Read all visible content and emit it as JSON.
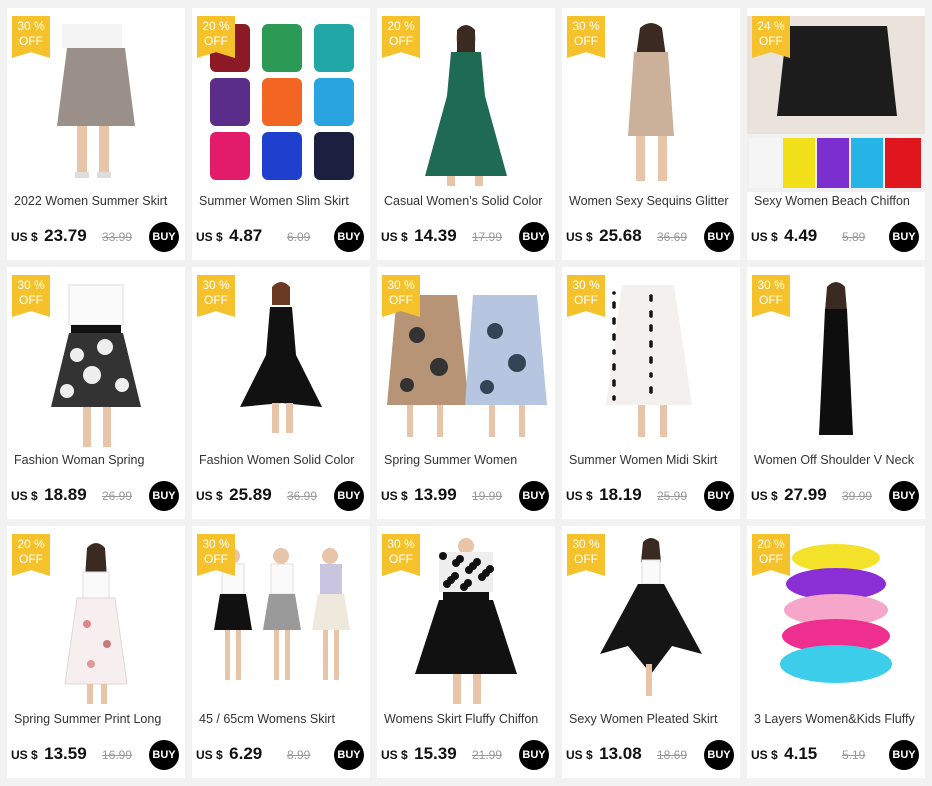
{
  "products": [
    {
      "discount_pct": "30 %",
      "discount_off": "OFF",
      "title": "2022 Women Summer Skirt",
      "currency": "US $",
      "price": "23.79",
      "original_price": "33.99",
      "buy_label": "BUY",
      "image_desc": "grey-pleated-skirt"
    },
    {
      "discount_pct": "20 %",
      "discount_off": "OFF",
      "title": "Summer Women Slim Skirt",
      "currency": "US $",
      "price": "4.87",
      "original_price": "6.09",
      "buy_label": "BUY",
      "image_desc": "multicolor-bodycon-skirts"
    },
    {
      "discount_pct": "20 %",
      "discount_off": "OFF",
      "title": "Casual Women's Solid Color",
      "currency": "US $",
      "price": "14.39",
      "original_price": "17.99",
      "buy_label": "BUY",
      "image_desc": "green-dress"
    },
    {
      "discount_pct": "30 %",
      "discount_off": "OFF",
      "title": "Women Sexy Sequins Glitter",
      "currency": "US $",
      "price": "25.68",
      "original_price": "36.69",
      "buy_label": "BUY",
      "image_desc": "sequin-dress"
    },
    {
      "discount_pct": "24 %",
      "discount_off": "OFF",
      "title": "Sexy Women Beach Chiffon",
      "currency": "US $",
      "price": "4.49",
      "original_price": "5.89",
      "buy_label": "BUY",
      "image_desc": "beach-chiffon-wrap"
    },
    {
      "discount_pct": "30 %",
      "discount_off": "OFF",
      "title": "Fashion Woman Spring",
      "currency": "US $",
      "price": "18.89",
      "original_price": "26.99",
      "buy_label": "BUY",
      "image_desc": "floral-skirt"
    },
    {
      "discount_pct": "30 %",
      "discount_off": "OFF",
      "title": "Fashion Women Solid Color",
      "currency": "US $",
      "price": "25.89",
      "original_price": "36.99",
      "buy_label": "BUY",
      "image_desc": "black-dress"
    },
    {
      "discount_pct": "30 %",
      "discount_off": "OFF",
      "title": "Spring Summer Women",
      "currency": "US $",
      "price": "13.99",
      "original_price": "19.99",
      "buy_label": "BUY",
      "image_desc": "floral-midi-skirts"
    },
    {
      "discount_pct": "30 %",
      "discount_off": "OFF",
      "title": "Summer Women Midi Skirt",
      "currency": "US $",
      "price": "18.19",
      "original_price": "25.99",
      "buy_label": "BUY",
      "image_desc": "polka-dot-skirt"
    },
    {
      "discount_pct": "30 %",
      "discount_off": "OFF",
      "title": "Women Off Shoulder V Neck",
      "currency": "US $",
      "price": "27.99",
      "original_price": "39.99",
      "buy_label": "BUY",
      "image_desc": "black-maxi-dress"
    },
    {
      "discount_pct": "20 %",
      "discount_off": "OFF",
      "title": "Spring Summer Print Long",
      "currency": "US $",
      "price": "13.59",
      "original_price": "16.99",
      "buy_label": "BUY",
      "image_desc": "white-print-long-skirt"
    },
    {
      "discount_pct": "30 %",
      "discount_off": "OFF",
      "title": "45 / 65cm Womens Skirt",
      "currency": "US $",
      "price": "6.29",
      "original_price": "8.99",
      "buy_label": "BUY",
      "image_desc": "short-skirts-three-models"
    },
    {
      "discount_pct": "30 %",
      "discount_off": "OFF",
      "title": "Womens Skirt Fluffy Chiffon",
      "currency": "US $",
      "price": "15.39",
      "original_price": "21.99",
      "buy_label": "BUY",
      "image_desc": "fluffy-black-skirt"
    },
    {
      "discount_pct": "30 %",
      "discount_off": "OFF",
      "title": "Sexy Women Pleated Skirt",
      "currency": "US $",
      "price": "13.08",
      "original_price": "18.69",
      "buy_label": "BUY",
      "image_desc": "black-pleated-skirt"
    },
    {
      "discount_pct": "20 %",
      "discount_off": "OFF",
      "title": "3 Layers Women&Kids Fluffy",
      "currency": "US $",
      "price": "4.15",
      "original_price": "5.19",
      "buy_label": "BUY",
      "image_desc": "layered-tutu-skirts"
    }
  ],
  "colors": {
    "badge": "#f5c22c",
    "buy_button": "#000000",
    "background": "#f2f2f2"
  }
}
